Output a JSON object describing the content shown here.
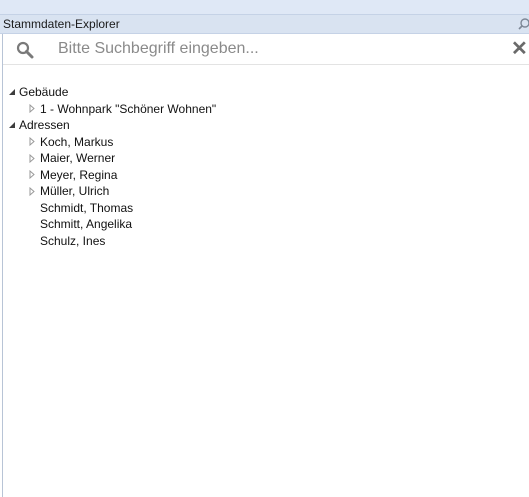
{
  "panel": {
    "title": "Stammdaten-Explorer"
  },
  "search": {
    "placeholder": "Bitte Suchbegriff eingeben...",
    "value": ""
  },
  "tree": {
    "gebaeude": {
      "label": "Gebäude",
      "expanded": true,
      "children": [
        {
          "label": "1 - Wohnpark \"Schöner Wohnen\"",
          "expandable": true
        }
      ]
    },
    "adressen": {
      "label": "Adressen",
      "expanded": true,
      "children": [
        {
          "label": "Koch, Markus",
          "expandable": true
        },
        {
          "label": "Maier, Werner",
          "expandable": true
        },
        {
          "label": "Meyer, Regina",
          "expandable": true
        },
        {
          "label": "Müller, Ulrich",
          "expandable": true
        },
        {
          "label": "Schmidt, Thomas",
          "expandable": false
        },
        {
          "label": "Schmitt, Angelika",
          "expandable": false
        },
        {
          "label": "Schulz, Ines",
          "expandable": false
        }
      ]
    }
  },
  "colors": {
    "title_bar": "#d9e3f1",
    "top_strip": "#dfe8f6",
    "arrow_collapsed": "#9a9a9a",
    "arrow_expanded": "#3c3c3c"
  }
}
